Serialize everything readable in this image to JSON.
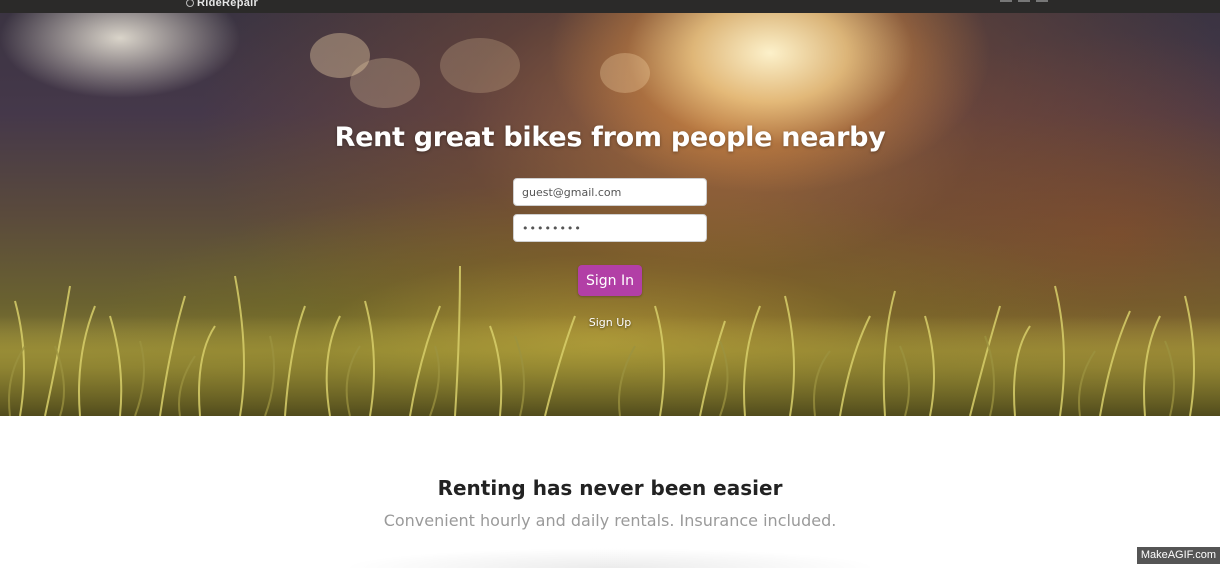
{
  "nav": {
    "logo_text": "RideRepair"
  },
  "hero": {
    "title": "Rent great bikes from people nearby",
    "email_value": "guest@gmail.com",
    "password_value": "••••••••",
    "signin_label": "Sign In",
    "signup_label": "Sign Up"
  },
  "section": {
    "title": "Renting has never been easier",
    "subtitle": "Convenient hourly and daily rentals. Insurance included."
  },
  "watermark": "MakeAGIF.com",
  "colors": {
    "accent": "#b23fa6",
    "navbar": "#2b2a29"
  }
}
